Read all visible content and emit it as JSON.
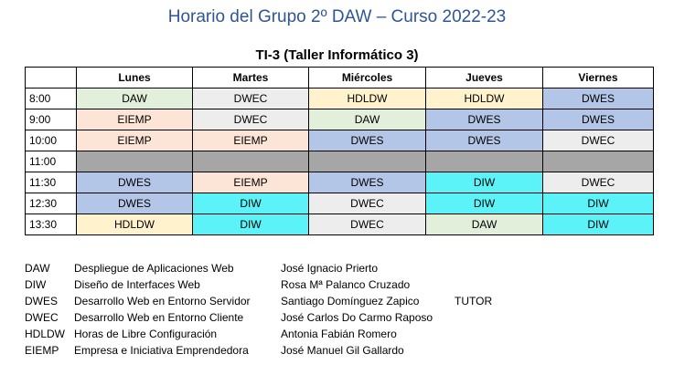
{
  "title": "Horario del Grupo 2º DAW – Curso 2022-23",
  "room": "TI-3 (Taller Informático 3)",
  "days": [
    "Lunes",
    "Martes",
    "Miércoles",
    "Jueves",
    "Viernes"
  ],
  "rows": [
    {
      "time": "8:00",
      "cells": [
        "DAW",
        "DWEC",
        "HDLDW",
        "HDLDW",
        "DWES"
      ]
    },
    {
      "time": "9:00",
      "cells": [
        "EIEMP",
        "DWEC",
        "DAW",
        "DWES",
        "DWES"
      ]
    },
    {
      "time": "10:00",
      "cells": [
        "EIEMP",
        "EIEMP",
        "DWES",
        "DWES",
        "DWEC"
      ]
    },
    {
      "time": "11:00",
      "cells": [
        "",
        "",
        "",
        "",
        ""
      ],
      "break": true
    },
    {
      "time": "11:30",
      "cells": [
        "DWES",
        "EIEMP",
        "DWES",
        "DIW",
        "DWEC"
      ]
    },
    {
      "time": "12:30",
      "cells": [
        "DWES",
        "DIW",
        "DWEC",
        "DIW",
        "DIW"
      ]
    },
    {
      "time": "13:30",
      "cells": [
        "HDLDW",
        "DIW",
        "DWEC",
        "DAW",
        "DIW"
      ]
    }
  ],
  "subject_colors": {
    "DAW": "#e2efda",
    "DWEC": "#ededed",
    "HDLDW": "#fff2cc",
    "DWES": "#b4c6e7",
    "EIEMP": "#fce4d6",
    "DIW": "#5bf3f7",
    "break": "#a6a6a6",
    "title": "#2f5597"
  },
  "legend": [
    {
      "code": "DAW",
      "name": "Despliegue de Aplicaciones Web",
      "teacher": "José Ignacio Prierto",
      "note": ""
    },
    {
      "code": "DIW",
      "name": "Diseño de Interfaces Web",
      "teacher": "Rosa Mª Palanco Cruzado",
      "note": ""
    },
    {
      "code": "DWES",
      "name": "Desarrollo Web en Entorno Servidor",
      "teacher": "Santiago Domínguez Zapico",
      "note": "TUTOR"
    },
    {
      "code": "DWEC",
      "name": "Desarrollo Web en Entorno Cliente",
      "teacher": "José Carlos Do Carmo Raposo",
      "note": ""
    },
    {
      "code": "HDLDW",
      "name": "Horas de Libre Configuración",
      "teacher": "Antonia Fabián Romero",
      "note": ""
    },
    {
      "code": "EIEMP",
      "name": "Empresa e Iniciativa Emprendedora",
      "teacher": "José Manuel Gil Gallardo",
      "note": ""
    }
  ]
}
